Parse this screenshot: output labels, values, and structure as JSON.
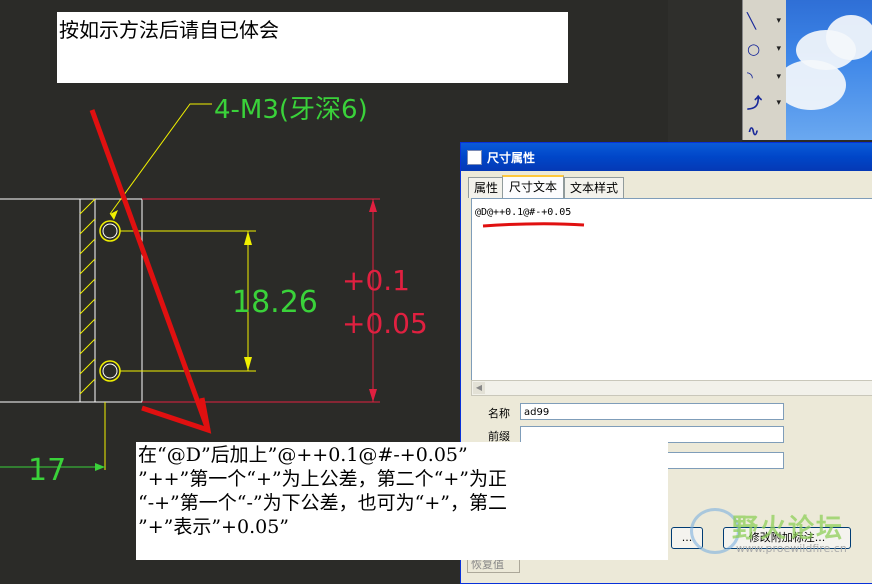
{
  "instruction_top": "按如示方法后请自已体会",
  "drawing": {
    "thread_note": "4-M3(牙深6)",
    "dim_main": "18.26",
    "tol_upper": "+0.1",
    "tol_lower": "+0.05",
    "dim_left": "17"
  },
  "instruction_bottom": {
    "line1": "在“@D”后加上”@++0.1@#-+0.05”",
    "line2": "”++”第一个“+”为上公差，第二个“+”为正",
    "line3": "“-+”第一个“-”为下公差，也可为“+”，第二",
    "line4": "”+”表示”+0.05”"
  },
  "dialog": {
    "title": "尺寸属性",
    "tabs": [
      {
        "label": "属性"
      },
      {
        "label": "尺寸文本"
      },
      {
        "label": "文本样式"
      }
    ],
    "text_value": "@D@++0.1@#-+0.05",
    "name_label": "名称",
    "name_value": "ad99",
    "prefix_label": "前缀",
    "prefix_value": "",
    "suffix_value": "",
    "btn_small": "...",
    "btn_modify": "修改附加标注...",
    "restore_label": "恢复值"
  },
  "watermark": {
    "text": "野火论坛",
    "url": "www.proewildfire.cn"
  },
  "colors": {
    "cad_bg": "#2b2b28",
    "cad_line": "#ffffff",
    "dim_yellow": "#f0f000",
    "dim_green": "#3ad23a",
    "dim_red": "#e02040",
    "annot_red": "#e01010",
    "xp_blue": "#0046c8"
  }
}
